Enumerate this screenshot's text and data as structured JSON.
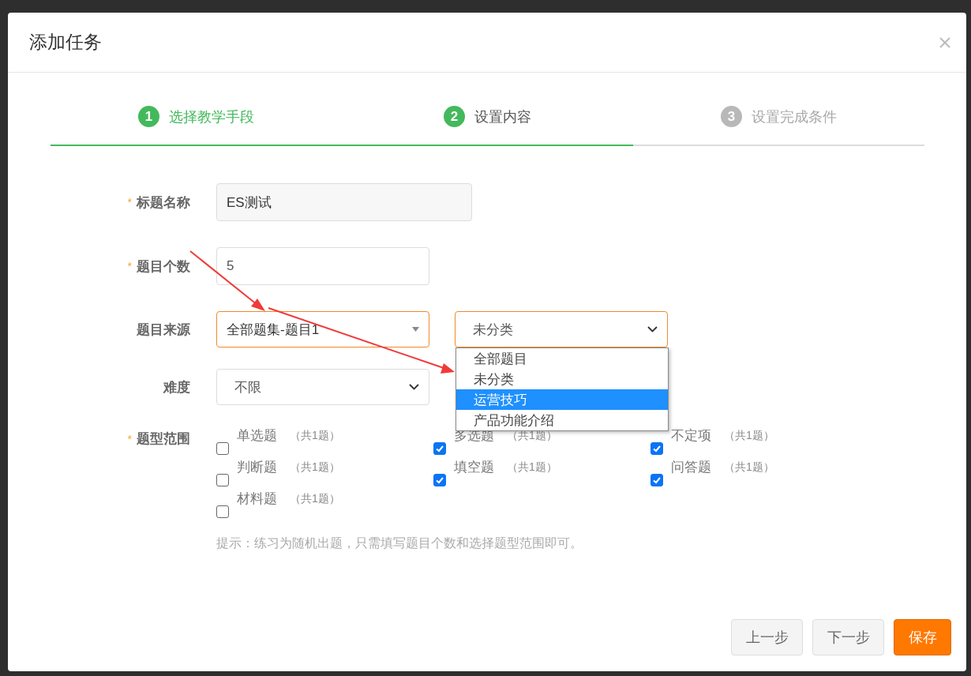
{
  "dialog": {
    "title": "添加任务"
  },
  "steps": [
    {
      "number": "1",
      "label": "选择教学手段",
      "completed": true,
      "current": false
    },
    {
      "number": "2",
      "label": "设置内容",
      "completed": false,
      "current": true
    },
    {
      "number": "3",
      "label": "设置完成条件",
      "completed": false,
      "current": false
    }
  ],
  "fields": [
    {
      "kind": "text",
      "label": "标题名称",
      "required_mark": "*",
      "value": "ES测试",
      "readonly": true
    },
    {
      "kind": "text",
      "label": "题目个数",
      "required_mark": "*",
      "value": "5",
      "readonly": false
    },
    {
      "kind": "selects",
      "label": "题目来源",
      "selects": [
        {
          "value": "全部题集-题目1",
          "kind": "triangle",
          "focused": true,
          "expanded": false
        },
        {
          "value": "未分类",
          "kind": "chevron",
          "focused": true,
          "expanded": true,
          "options": [
            {
              "label": "全部题目",
              "highlighted": false
            },
            {
              "label": "未分类",
              "highlighted": false
            },
            {
              "label": "运营技巧",
              "highlighted": true
            },
            {
              "label": "产品功能介绍",
              "highlighted": false
            }
          ]
        }
      ]
    },
    {
      "kind": "selects",
      "label": "难度",
      "selects": [
        {
          "value": "不限",
          "kind": "chevron",
          "focused": false,
          "expanded": false
        }
      ]
    }
  ],
  "question_types": {
    "label": "题型范围",
    "required_mark": "*",
    "items": [
      {
        "name": "单选题",
        "count": "（共1题）",
        "checked": false
      },
      {
        "name": "多选题",
        "count": "（共1题）",
        "checked": true
      },
      {
        "name": "不定项",
        "count": "（共1题）",
        "checked": true
      },
      {
        "name": "判断题",
        "count": "（共1题）",
        "checked": false
      },
      {
        "name": "填空题",
        "count": "（共1题）",
        "checked": true
      },
      {
        "name": "问答题",
        "count": "（共1题）",
        "checked": true
      },
      {
        "name": "材料题",
        "count": "（共1题）",
        "checked": false
      }
    ]
  },
  "hint": "提示：练习为随机出题，只需填写题目个数和选择题型范围即可。",
  "buttons": [
    {
      "label": "上一步",
      "kind": "secondary"
    },
    {
      "label": "下一步",
      "kind": "secondary"
    },
    {
      "label": "保存",
      "kind": "primary"
    }
  ]
}
